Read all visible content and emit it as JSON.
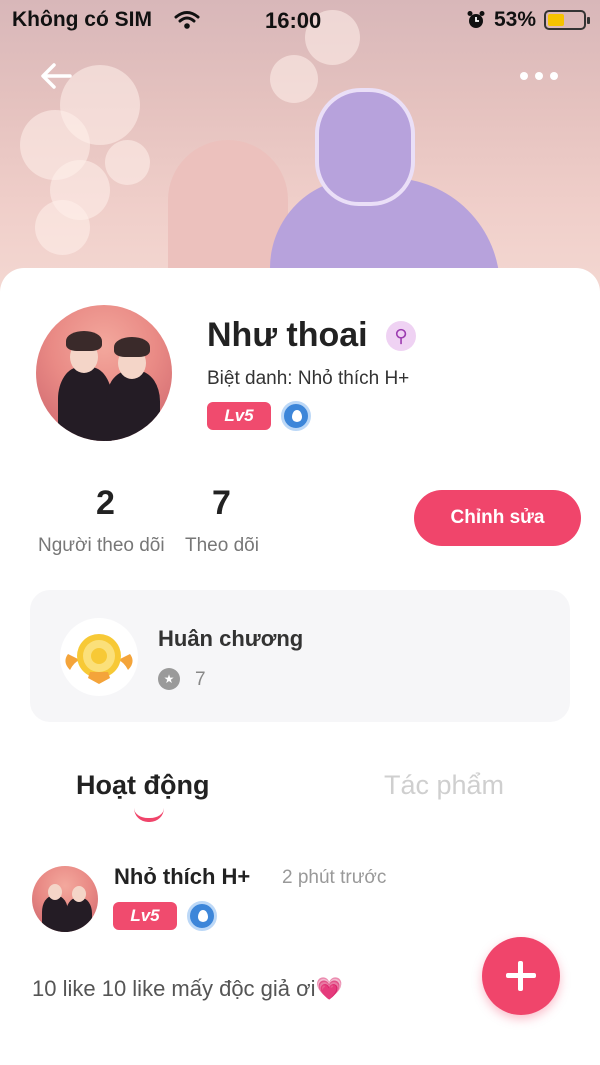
{
  "status_bar": {
    "carrier": "Không có SIM",
    "time": "16:00",
    "battery": "53%",
    "battery_level": 0.53,
    "icons": [
      "wifi-icon",
      "alarm-icon",
      "battery-icon"
    ]
  },
  "header": {
    "back_icon": "arrow-left-icon",
    "more_icon": "more-dots-icon"
  },
  "profile": {
    "name": "Như thoai",
    "gender_icon": "female-icon",
    "nickname": "Biệt danh: Nhỏ thích H+",
    "level": "Lv5",
    "badge_icon": "water-drop-badge-icon"
  },
  "stats": {
    "followers_count": "2",
    "followers_label": "Người theo dõi",
    "following_count": "7",
    "following_label": "Theo dõi"
  },
  "edit_button": "Chỉnh sửa",
  "medal": {
    "title": "Huân chương",
    "count": "7",
    "icon": "medal-icon"
  },
  "tabs": [
    {
      "label": "Hoạt động",
      "active": true
    },
    {
      "label": "Tác phẩm",
      "active": false
    }
  ],
  "post": {
    "author": "Nhỏ thích H+",
    "time": "2 phút trước",
    "level": "Lv5",
    "text": "10 like 10 like mấy độc giả ơi",
    "emoji": "💗"
  },
  "fab_icon": "plus-icon",
  "colors": {
    "accent": "#f0456b",
    "level_badge": "#f04b6e",
    "card_bg": "#f6f6f8"
  }
}
